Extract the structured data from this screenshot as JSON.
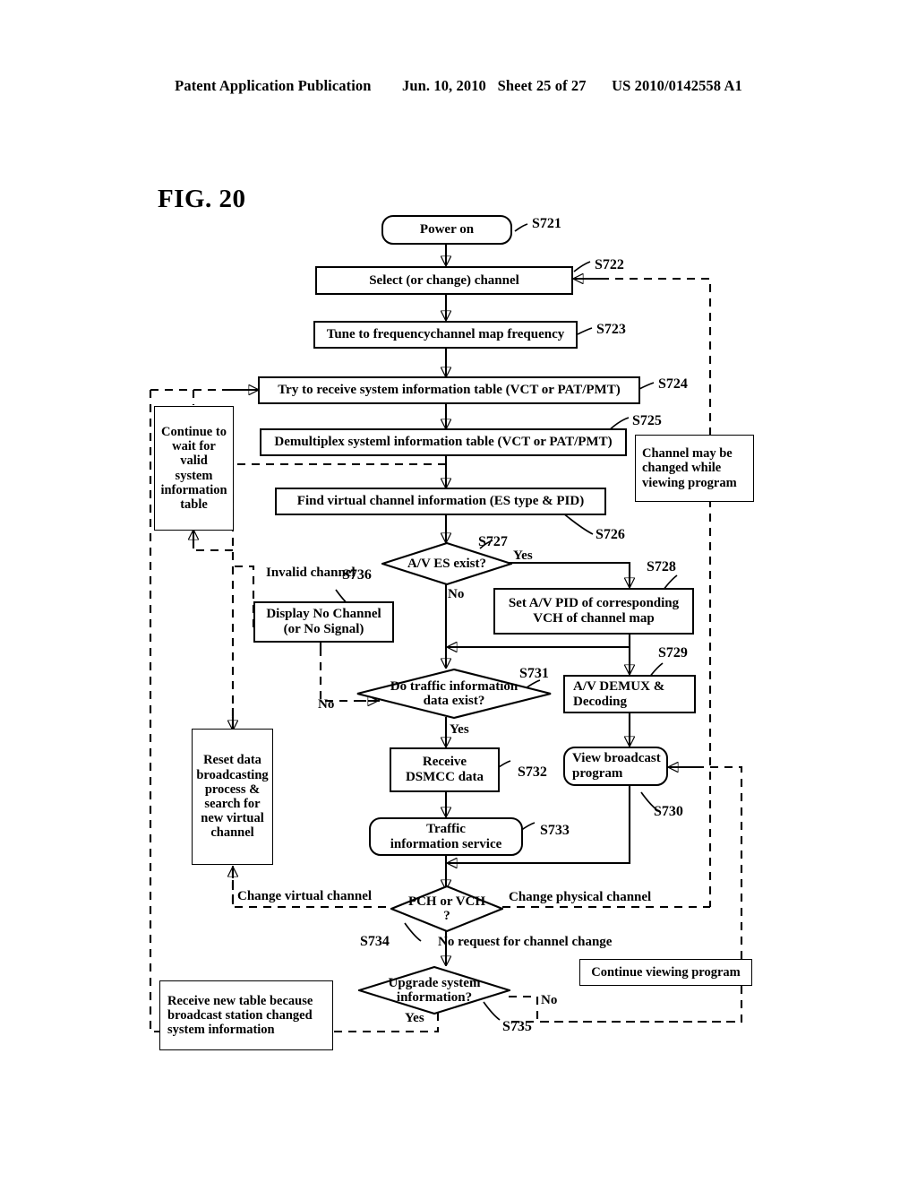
{
  "header": {
    "publication": "Patent Application Publication",
    "date": "Jun. 10, 2010",
    "sheet": "Sheet 25 of 27",
    "patent_number": "US 2010/0142558 A1"
  },
  "figure": {
    "label": "FIG. 20"
  },
  "chart_data": {
    "type": "diagram",
    "title": "FIG. 20"
  },
  "nodes": {
    "s721": {
      "text": "Power on",
      "ref": "S721",
      "shape": "rounded"
    },
    "s722": {
      "text": "Select (or change) channel",
      "ref": "S722",
      "shape": "rect"
    },
    "s723": {
      "text": "Tune to frequencychannel map frequency",
      "ref": "S723",
      "shape": "rect"
    },
    "s724": {
      "text": "Try to receive system information table (VCT or PAT/PMT)",
      "ref": "S724",
      "shape": "rect"
    },
    "s725": {
      "text": "Demultiplex systeml information table (VCT or PAT/PMT)",
      "ref": "S725",
      "shape": "rect"
    },
    "s726": {
      "text": "Find virtual channel information (ES type & PID)",
      "ref": "S726",
      "shape": "rect"
    },
    "s727": {
      "text": "A/V ES exist?",
      "ref": "S727",
      "shape": "diamond"
    },
    "s728": {
      "text": "Set A/V PID of corresponding VCH of channel map",
      "ref": "S728",
      "shape": "rect"
    },
    "s729": {
      "text": "A/V DEMUX & Decoding",
      "ref": "S729",
      "shape": "rect"
    },
    "s730": {
      "text": "View broadcast program",
      "ref": "S730",
      "shape": "rounded"
    },
    "s731": {
      "text": "Do traffic information data exist?",
      "ref": "S731",
      "shape": "diamond"
    },
    "s732": {
      "text": "Receive DSMCC data",
      "ref": "S732",
      "shape": "rect"
    },
    "s733": {
      "text": "Traffic information service",
      "ref": "S733",
      "shape": "rounded"
    },
    "s734": {
      "text": "PCH or VCH ?",
      "ref": "S734",
      "shape": "diamond"
    },
    "s735": {
      "text": "Upgrade system information?",
      "ref": "S735",
      "shape": "diamond"
    },
    "s736": {
      "text": "Display No Channel (or No Signal)",
      "ref": "S736",
      "shape": "rect"
    },
    "wait_box": {
      "text": "Continue to wait for valid system information table",
      "shape": "rect"
    },
    "channel_note": {
      "text": "Channel may be changed while viewing program",
      "shape": "rect"
    },
    "reset_box": {
      "text": "Reset data broadcasting process & search for new virtual channel",
      "shape": "rect"
    },
    "new_table_box": {
      "text": "Receive new table because broadcast station changed system information",
      "shape": "rect"
    },
    "continue_view_box": {
      "text": "Continue viewing program",
      "shape": "rect"
    }
  },
  "node_lines": {
    "s721": [
      "Power on"
    ],
    "s722": [
      "Select (or change) channel"
    ],
    "s723": [
      "Tune to frequencychannel map frequency"
    ],
    "s724": [
      "Try to receive system information table (VCT or PAT/PMT)"
    ],
    "s725": [
      "Demultiplex systeml information table (VCT or PAT/PMT)"
    ],
    "s726": [
      "Find virtual channel information (ES type & PID)"
    ],
    "s727": [
      "A/V ES exist?"
    ],
    "s728": [
      "Set A/V PID of corresponding",
      "VCH of channel map"
    ],
    "s729": [
      "A/V DEMUX &",
      "Decoding"
    ],
    "s730": [
      "View broadcast",
      "program"
    ],
    "s731": [
      "Do traffic information",
      "data exist?"
    ],
    "s732": [
      "Receive",
      "DSMCC data"
    ],
    "s733": [
      "Traffic",
      "information service"
    ],
    "s734": [
      "PCH or VCH",
      "?"
    ],
    "s735": [
      "Upgrade system",
      "information?"
    ],
    "s736": [
      "Display No Channel",
      "(or No Signal)"
    ],
    "wait_box": [
      "Continue to",
      "wait for",
      "valid",
      "system",
      "information",
      "table"
    ],
    "channel_note": [
      "Channel may be",
      "changed while",
      "viewing program"
    ],
    "reset_box": [
      "Reset data",
      "broadcasting",
      "process &",
      "search for",
      "new virtual",
      "channel"
    ],
    "new_table_box": [
      "Receive new table because",
      "broadcast station changed",
      "system information"
    ],
    "continue_view_box": [
      "Continue viewing program"
    ]
  },
  "step_refs": {
    "s721": "S721",
    "s722": "S722",
    "s723": "S723",
    "s724": "S724",
    "s725": "S725",
    "s726": "S726",
    "s727": "S727",
    "s728": "S728",
    "s729": "S729",
    "s730": "S730",
    "s731": "S731",
    "s732": "S732",
    "s733": "S733",
    "s734": "S734",
    "s735": "S735",
    "s736": "S736"
  },
  "edge_labels": {
    "av_yes": "Yes",
    "av_no": "No",
    "traffic_yes": "Yes",
    "traffic_no": "No",
    "invalid_channel": "Invalid channel",
    "change_virtual": "Change virtual channel",
    "change_physical": "Change physical channel",
    "no_request": "No request for channel change",
    "upgrade_yes": "Yes",
    "upgrade_no": "No"
  },
  "colors": {
    "ink": "#000000",
    "paper": "#ffffff"
  }
}
